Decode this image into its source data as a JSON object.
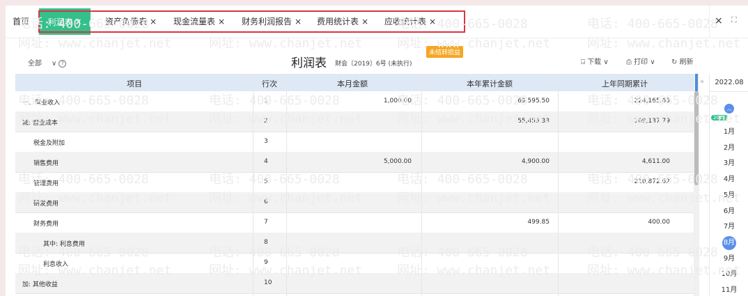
{
  "tabs": {
    "home": "首页",
    "active": "利润表",
    "items": [
      "资产负债表",
      "现金流量表",
      "财务利润报告",
      "费用统计表",
      "应收统计表"
    ],
    "close_glyph": "×"
  },
  "window_controls": {
    "close": "×",
    "fullscreen": "⛶"
  },
  "watermark": {
    "phone": "电话: 400-665-0028",
    "site": "网址: www.chanjet.net"
  },
  "toolbar": {
    "filter": "全部",
    "title": "利润表",
    "subtitle": "财会〔2019〕6号 (未执行)",
    "status": "未结转损益",
    "download": "下载",
    "print": "打印",
    "refresh": "刷新"
  },
  "table": {
    "headers": [
      "项目",
      "行次",
      "本月金额",
      "本年累计金额",
      "上年同期累计"
    ],
    "rows": [
      {
        "item": "一、营业收入",
        "line": "1",
        "month": "1,000.00",
        "ytd": "69,595.50",
        "prior": "224,165.63"
      },
      {
        "item": "减: 营业成本",
        "line": "2",
        "month": "",
        "ytd": "55,453.33",
        "prior": "109,137.79"
      },
      {
        "item": "税金及附加",
        "line": "3",
        "month": "",
        "ytd": "",
        "prior": ""
      },
      {
        "item": "销售费用",
        "line": "4",
        "month": "5,000.00",
        "ytd": "4,900.00",
        "prior": "4,611.00"
      },
      {
        "item": "管理费用",
        "line": "5",
        "month": "",
        "ytd": "",
        "prior": "210,872.62"
      },
      {
        "item": "研发费用",
        "line": "6",
        "month": "",
        "ytd": "",
        "prior": ""
      },
      {
        "item": "财务费用",
        "line": "7",
        "month": "",
        "ytd": "499.85",
        "prior": "400.00"
      },
      {
        "item": "其中: 利息费用",
        "line": "8",
        "month": "",
        "ytd": "",
        "prior": ""
      },
      {
        "item": "利息收入",
        "line": "9",
        "month": "",
        "ytd": "",
        "prior": ""
      },
      {
        "item": "加: 其他收益",
        "line": "10",
        "month": "",
        "ytd": "",
        "prior": ""
      }
    ]
  },
  "month_panel": {
    "current": "2022.08",
    "year": "2022",
    "months": [
      "1月",
      "2月",
      "3月",
      "4月",
      "5月",
      "6月",
      "7月",
      "8月",
      "9月",
      "10月",
      "11月"
    ],
    "selected": "8月"
  },
  "colors": {
    "accent_green": "#33c08c",
    "highlight_red": "#d9363e",
    "badge_orange": "#f5a623",
    "header_blue": "#dfe8f5",
    "month_blue": "#5b8fe8"
  }
}
